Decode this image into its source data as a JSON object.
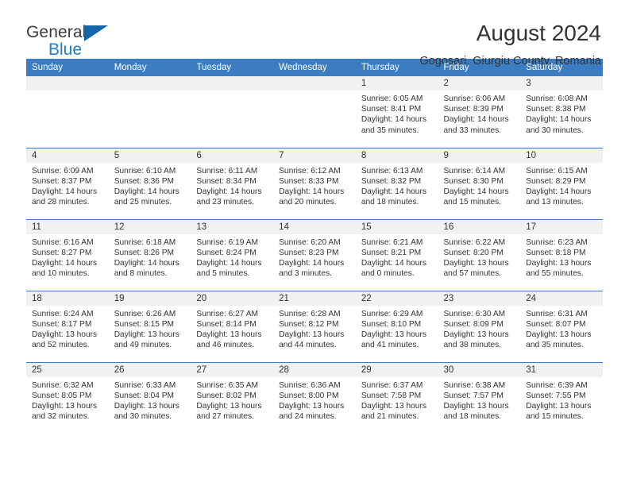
{
  "brand": {
    "name_top": "General",
    "name_bottom": "Blue",
    "triangle_color": "#1565a8",
    "blue_color": "#1f7fd0"
  },
  "header": {
    "title": "August 2024",
    "subtitle": "Gogosari, Giurgiu County, Romania"
  },
  "theme": {
    "header_bg": "#3b7dc0",
    "daynum_bg": "#f1f1f1",
    "text": "#333333"
  },
  "labels": {
    "sunrise_prefix": "Sunrise:",
    "sunset_prefix": "Sunset:",
    "daylight_prefix": "Daylight:"
  },
  "weekdays": [
    "Sunday",
    "Monday",
    "Tuesday",
    "Wednesday",
    "Thursday",
    "Friday",
    "Saturday"
  ],
  "weeks": [
    [
      {
        "day": "",
        "empty": true
      },
      {
        "day": "",
        "empty": true
      },
      {
        "day": "",
        "empty": true
      },
      {
        "day": "",
        "empty": true
      },
      {
        "day": "1",
        "sunrise": "Sunrise: 6:05 AM",
        "sunset": "Sunset: 8:41 PM",
        "daylight": "Daylight: 14 hours and 35 minutes."
      },
      {
        "day": "2",
        "sunrise": "Sunrise: 6:06 AM",
        "sunset": "Sunset: 8:39 PM",
        "daylight": "Daylight: 14 hours and 33 minutes."
      },
      {
        "day": "3",
        "sunrise": "Sunrise: 6:08 AM",
        "sunset": "Sunset: 8:38 PM",
        "daylight": "Daylight: 14 hours and 30 minutes."
      }
    ],
    [
      {
        "day": "4",
        "sunrise": "Sunrise: 6:09 AM",
        "sunset": "Sunset: 8:37 PM",
        "daylight": "Daylight: 14 hours and 28 minutes."
      },
      {
        "day": "5",
        "sunrise": "Sunrise: 6:10 AM",
        "sunset": "Sunset: 8:36 PM",
        "daylight": "Daylight: 14 hours and 25 minutes."
      },
      {
        "day": "6",
        "sunrise": "Sunrise: 6:11 AM",
        "sunset": "Sunset: 8:34 PM",
        "daylight": "Daylight: 14 hours and 23 minutes."
      },
      {
        "day": "7",
        "sunrise": "Sunrise: 6:12 AM",
        "sunset": "Sunset: 8:33 PM",
        "daylight": "Daylight: 14 hours and 20 minutes."
      },
      {
        "day": "8",
        "sunrise": "Sunrise: 6:13 AM",
        "sunset": "Sunset: 8:32 PM",
        "daylight": "Daylight: 14 hours and 18 minutes."
      },
      {
        "day": "9",
        "sunrise": "Sunrise: 6:14 AM",
        "sunset": "Sunset: 8:30 PM",
        "daylight": "Daylight: 14 hours and 15 minutes."
      },
      {
        "day": "10",
        "sunrise": "Sunrise: 6:15 AM",
        "sunset": "Sunset: 8:29 PM",
        "daylight": "Daylight: 14 hours and 13 minutes."
      }
    ],
    [
      {
        "day": "11",
        "sunrise": "Sunrise: 6:16 AM",
        "sunset": "Sunset: 8:27 PM",
        "daylight": "Daylight: 14 hours and 10 minutes."
      },
      {
        "day": "12",
        "sunrise": "Sunrise: 6:18 AM",
        "sunset": "Sunset: 8:26 PM",
        "daylight": "Daylight: 14 hours and 8 minutes."
      },
      {
        "day": "13",
        "sunrise": "Sunrise: 6:19 AM",
        "sunset": "Sunset: 8:24 PM",
        "daylight": "Daylight: 14 hours and 5 minutes."
      },
      {
        "day": "14",
        "sunrise": "Sunrise: 6:20 AM",
        "sunset": "Sunset: 8:23 PM",
        "daylight": "Daylight: 14 hours and 3 minutes."
      },
      {
        "day": "15",
        "sunrise": "Sunrise: 6:21 AM",
        "sunset": "Sunset: 8:21 PM",
        "daylight": "Daylight: 14 hours and 0 minutes."
      },
      {
        "day": "16",
        "sunrise": "Sunrise: 6:22 AM",
        "sunset": "Sunset: 8:20 PM",
        "daylight": "Daylight: 13 hours and 57 minutes."
      },
      {
        "day": "17",
        "sunrise": "Sunrise: 6:23 AM",
        "sunset": "Sunset: 8:18 PM",
        "daylight": "Daylight: 13 hours and 55 minutes."
      }
    ],
    [
      {
        "day": "18",
        "sunrise": "Sunrise: 6:24 AM",
        "sunset": "Sunset: 8:17 PM",
        "daylight": "Daylight: 13 hours and 52 minutes."
      },
      {
        "day": "19",
        "sunrise": "Sunrise: 6:26 AM",
        "sunset": "Sunset: 8:15 PM",
        "daylight": "Daylight: 13 hours and 49 minutes."
      },
      {
        "day": "20",
        "sunrise": "Sunrise: 6:27 AM",
        "sunset": "Sunset: 8:14 PM",
        "daylight": "Daylight: 13 hours and 46 minutes."
      },
      {
        "day": "21",
        "sunrise": "Sunrise: 6:28 AM",
        "sunset": "Sunset: 8:12 PM",
        "daylight": "Daylight: 13 hours and 44 minutes."
      },
      {
        "day": "22",
        "sunrise": "Sunrise: 6:29 AM",
        "sunset": "Sunset: 8:10 PM",
        "daylight": "Daylight: 13 hours and 41 minutes."
      },
      {
        "day": "23",
        "sunrise": "Sunrise: 6:30 AM",
        "sunset": "Sunset: 8:09 PM",
        "daylight": "Daylight: 13 hours and 38 minutes."
      },
      {
        "day": "24",
        "sunrise": "Sunrise: 6:31 AM",
        "sunset": "Sunset: 8:07 PM",
        "daylight": "Daylight: 13 hours and 35 minutes."
      }
    ],
    [
      {
        "day": "25",
        "sunrise": "Sunrise: 6:32 AM",
        "sunset": "Sunset: 8:05 PM",
        "daylight": "Daylight: 13 hours and 32 minutes."
      },
      {
        "day": "26",
        "sunrise": "Sunrise: 6:33 AM",
        "sunset": "Sunset: 8:04 PM",
        "daylight": "Daylight: 13 hours and 30 minutes."
      },
      {
        "day": "27",
        "sunrise": "Sunrise: 6:35 AM",
        "sunset": "Sunset: 8:02 PM",
        "daylight": "Daylight: 13 hours and 27 minutes."
      },
      {
        "day": "28",
        "sunrise": "Sunrise: 6:36 AM",
        "sunset": "Sunset: 8:00 PM",
        "daylight": "Daylight: 13 hours and 24 minutes."
      },
      {
        "day": "29",
        "sunrise": "Sunrise: 6:37 AM",
        "sunset": "Sunset: 7:58 PM",
        "daylight": "Daylight: 13 hours and 21 minutes."
      },
      {
        "day": "30",
        "sunrise": "Sunrise: 6:38 AM",
        "sunset": "Sunset: 7:57 PM",
        "daylight": "Daylight: 13 hours and 18 minutes."
      },
      {
        "day": "31",
        "sunrise": "Sunrise: 6:39 AM",
        "sunset": "Sunset: 7:55 PM",
        "daylight": "Daylight: 13 hours and 15 minutes."
      }
    ]
  ]
}
